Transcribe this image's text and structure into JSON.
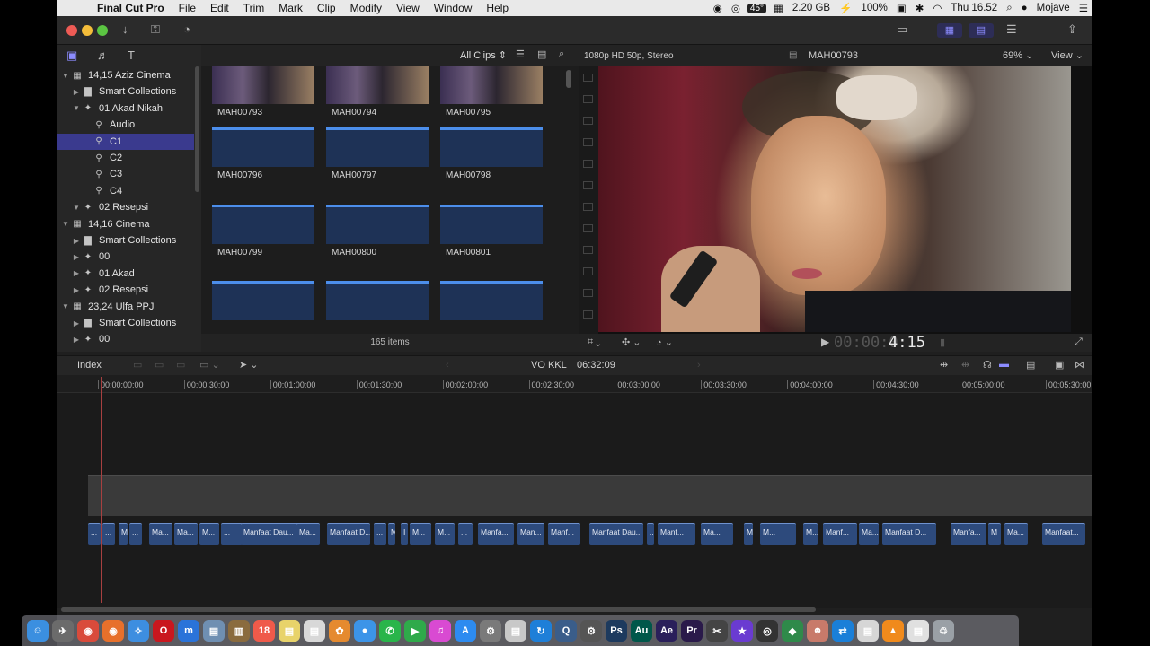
{
  "menubar": {
    "app_name": "Final Cut Pro",
    "menus": [
      "File",
      "Edit",
      "Trim",
      "Mark",
      "Clip",
      "Modify",
      "View",
      "Window",
      "Help"
    ],
    "temp": "45°",
    "memory": "2.20 GB",
    "battery": "100%",
    "clock": "Thu 16.52",
    "user": "Mojave"
  },
  "library": {
    "items": [
      {
        "label": "14,15 Aziz Cinema",
        "tri": "▼",
        "icon": "▦"
      },
      {
        "label": "Smart Collections",
        "tri": "▶",
        "icon": "▇"
      },
      {
        "label": "01 Akad Nikah",
        "tri": "▼",
        "icon": "✦"
      },
      {
        "label": "Audio",
        "tri": "",
        "icon": "⚲"
      },
      {
        "label": "C1",
        "tri": "",
        "icon": "⚲"
      },
      {
        "label": "C2",
        "tri": "",
        "icon": "⚲"
      },
      {
        "label": "C3",
        "tri": "",
        "icon": "⚲"
      },
      {
        "label": "C4",
        "tri": "",
        "icon": "⚲"
      },
      {
        "label": "02 Resepsi",
        "tri": "▼",
        "icon": "✦"
      },
      {
        "label": "14,16 Cinema",
        "tri": "▼",
        "icon": "▦"
      },
      {
        "label": "Smart Collections",
        "tri": "▶",
        "icon": "▇"
      },
      {
        "label": "00",
        "tri": "▶",
        "icon": "✦"
      },
      {
        "label": "01 Akad",
        "tri": "▶",
        "icon": "✦"
      },
      {
        "label": "02 Resepsi",
        "tri": "▶",
        "icon": "✦"
      },
      {
        "label": "23,24 Ulfa PPJ",
        "tri": "▼",
        "icon": "▦"
      },
      {
        "label": "Smart Collections",
        "tri": "▶",
        "icon": "▇"
      },
      {
        "label": "00",
        "tri": "▶",
        "icon": "✦"
      }
    ]
  },
  "browser": {
    "filter": "All Clips",
    "clips": [
      "MAH00793",
      "MAH00794",
      "MAH00795",
      "MAH00796",
      "MAH00797",
      "MAH00798",
      "MAH00799",
      "MAH00800",
      "MAH00801",
      "",
      "",
      ""
    ],
    "item_count": "165 items"
  },
  "viewer": {
    "format": "1080p HD 50p, Stereo",
    "clip_name": "MAH00793",
    "zoom": "69%",
    "view_label": "View",
    "timecode_dim": "00:00:0",
    "timecode": "4:15"
  },
  "timeline": {
    "index_label": "Index",
    "project": "VO KKL",
    "duration": "06:32:09",
    "ruler": [
      "00:00:00:00",
      "00:00:30:00",
      "00:01:00:00",
      "00:01:30:00",
      "00:02:00:00",
      "00:02:30:00",
      "00:03:00:00",
      "00:03:30:00",
      "00:04:00:00",
      "00:04:30:00",
      "00:05:00:00",
      "00:05:30:00"
    ],
    "clips": [
      "...",
      "...",
      "M",
      "...",
      "Ma...",
      "Ma...",
      "M...",
      "...",
      "Manfaat Dau...",
      "Ma...",
      "Manfaat D...",
      "...",
      "M",
      "I",
      "M...",
      "M...",
      "...",
      "Manfa...",
      "Man...",
      "Manf...",
      "Manfaat Dau...",
      "...",
      "Manf...",
      "Ma...",
      "M",
      "M...",
      "M...",
      "Manf...",
      "Ma...",
      "Manfaat D...",
      "Manfa...",
      "M",
      "Ma...",
      "Manfaat..."
    ]
  },
  "dock": {
    "items": [
      {
        "name": "finder-icon",
        "glyph": "☺",
        "color": "#3b8fe0"
      },
      {
        "name": "launchpad-icon",
        "glyph": "✈",
        "color": "#6b6b6b"
      },
      {
        "name": "chrome-icon",
        "glyph": "◉",
        "color": "#d94b3b"
      },
      {
        "name": "firefox-icon",
        "glyph": "◉",
        "color": "#e7702b"
      },
      {
        "name": "safari-icon",
        "glyph": "✧",
        "color": "#3d8ee0"
      },
      {
        "name": "opera-icon",
        "glyph": "O",
        "color": "#c9171e"
      },
      {
        "name": "maxthon-icon",
        "glyph": "m",
        "color": "#2a73d9"
      },
      {
        "name": "preview-icon",
        "glyph": "▤",
        "color": "#6f8fb2"
      },
      {
        "name": "notebook-icon",
        "glyph": "▥",
        "color": "#8a6b3e"
      },
      {
        "name": "calendar-icon",
        "glyph": "18",
        "color": "#ef5a4a"
      },
      {
        "name": "notes-icon",
        "glyph": "▤",
        "color": "#e8d36a"
      },
      {
        "name": "textedit-icon",
        "glyph": "▤",
        "color": "#d8d8d8"
      },
      {
        "name": "photos-icon",
        "glyph": "✿",
        "color": "#e58a2f"
      },
      {
        "name": "messages-icon",
        "glyph": "●",
        "color": "#3c94e8"
      },
      {
        "name": "whatsapp-icon",
        "glyph": "✆",
        "color": "#29b54a"
      },
      {
        "name": "facetime-icon",
        "glyph": "▶",
        "color": "#2faa4a"
      },
      {
        "name": "music-icon",
        "glyph": "♫",
        "color": "#d94ad2"
      },
      {
        "name": "appstore-icon",
        "glyph": "A",
        "color": "#2d8bf0"
      },
      {
        "name": "system-prefs-icon",
        "glyph": "⚙",
        "color": "#7a7a7a"
      },
      {
        "name": "notepad-icon",
        "glyph": "▤",
        "color": "#c8c8c8"
      },
      {
        "name": "sync-icon",
        "glyph": "↻",
        "color": "#1e7fd8"
      },
      {
        "name": "quicktime-icon",
        "glyph": "Q",
        "color": "#3a5d8a"
      },
      {
        "name": "compressor-icon",
        "glyph": "⚙",
        "color": "#555"
      },
      {
        "name": "photoshop-icon",
        "glyph": "Ps",
        "color": "#1d3a5e"
      },
      {
        "name": "audition-icon",
        "glyph": "Au",
        "color": "#00574a"
      },
      {
        "name": "aftereffects-icon",
        "glyph": "Ae",
        "color": "#2a1f5a"
      },
      {
        "name": "premiere-icon",
        "glyph": "Pr",
        "color": "#2a1a4a"
      },
      {
        "name": "finalcut-icon",
        "glyph": "✂",
        "color": "#444"
      },
      {
        "name": "imovie-icon",
        "glyph": "★",
        "color": "#6a3bd1"
      },
      {
        "name": "davinci-icon",
        "glyph": "◎",
        "color": "#333"
      },
      {
        "name": "motion-icon",
        "glyph": "◆",
        "color": "#2f8a4a"
      },
      {
        "name": "character-icon",
        "glyph": "☻",
        "color": "#c87a6a"
      },
      {
        "name": "teamviewer-icon",
        "glyph": "⇄",
        "color": "#1a7fd8"
      },
      {
        "name": "doc-icon",
        "glyph": "▤",
        "color": "#d6d6d6"
      },
      {
        "name": "vlc-icon",
        "glyph": "▲",
        "color": "#f08a1c"
      },
      {
        "name": "files-icon",
        "glyph": "▤",
        "color": "#e0e0e0"
      },
      {
        "name": "trash-icon",
        "glyph": "♲",
        "color": "#9aa0a6"
      }
    ]
  }
}
